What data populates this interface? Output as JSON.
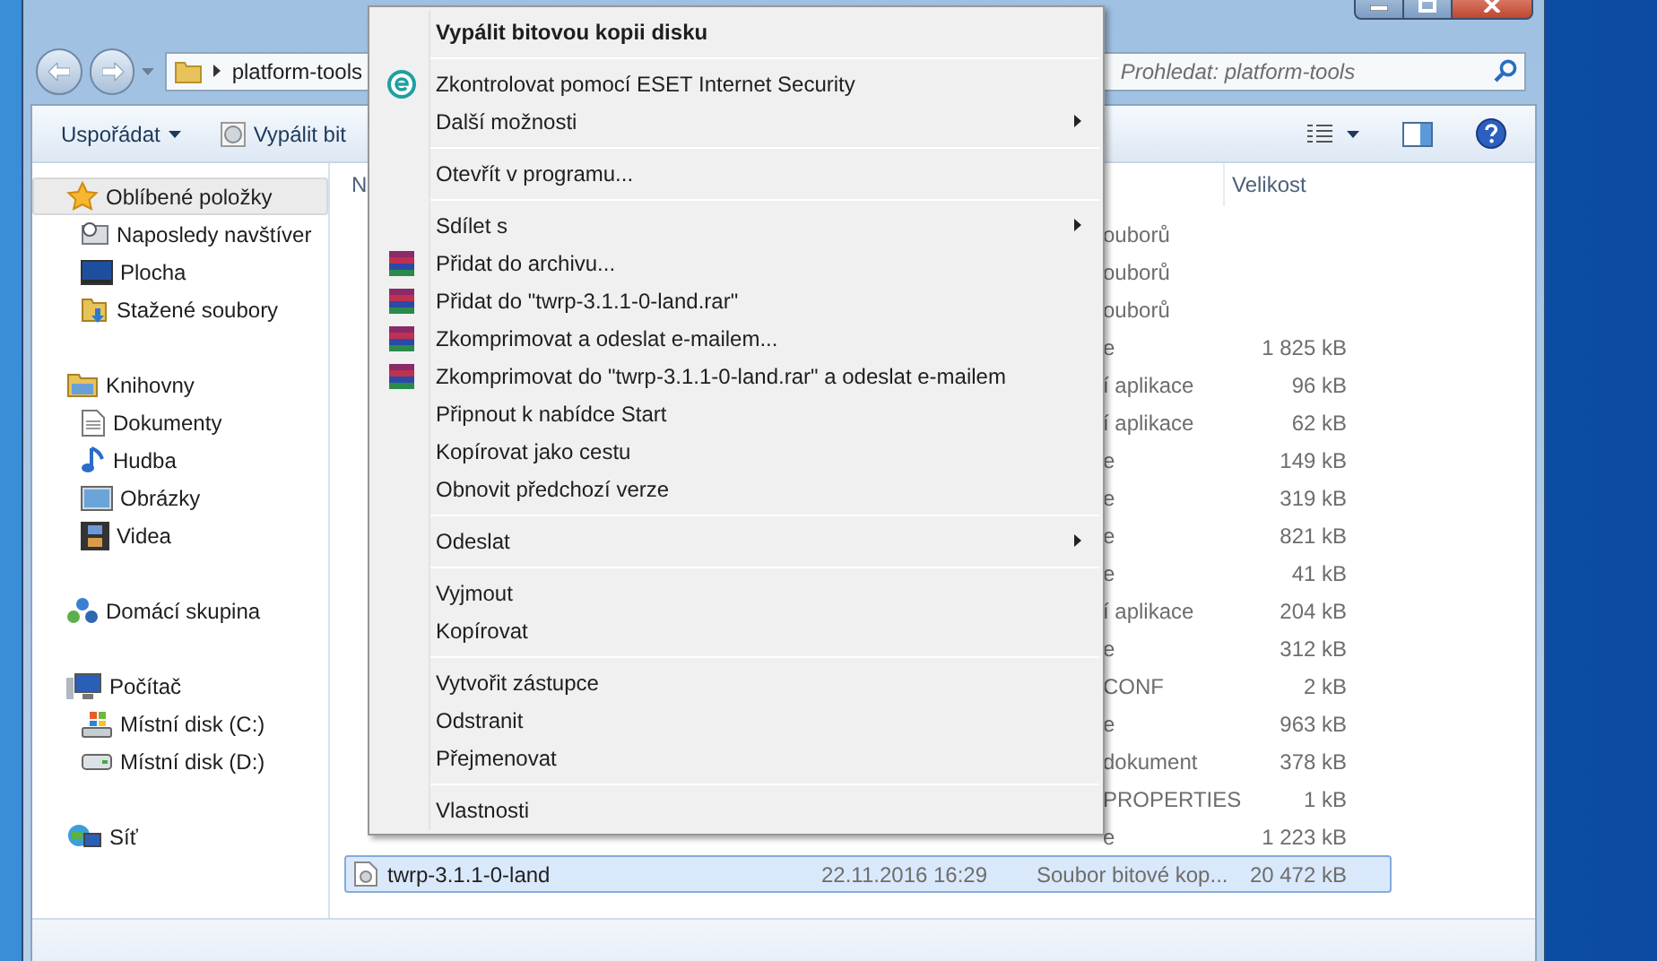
{
  "address_bar": {
    "path": "platform-tools"
  },
  "search": {
    "placeholder": "Prohledat: platform-tools"
  },
  "toolbar": {
    "buttons": [
      {
        "label": "Uspořádat",
        "kind": "dropdown"
      },
      {
        "label": "Vypálit bit",
        "kind": "burn"
      }
    ]
  },
  "sidebar": {
    "groups": [
      {
        "label": "Oblíbené položky",
        "selected": true,
        "children": [
          {
            "label": "Naposledy navštíver",
            "selected": false
          },
          {
            "label": "Plocha",
            "selected": false
          },
          {
            "label": "Stažené soubory",
            "selected": false
          }
        ]
      },
      {
        "label": "Knihovny",
        "selected": false,
        "children": [
          {
            "label": "Dokumenty",
            "selected": false
          },
          {
            "label": "Hudba",
            "selected": false
          },
          {
            "label": "Obrázky",
            "selected": false
          },
          {
            "label": "Videa",
            "selected": false
          }
        ]
      },
      {
        "label": "Domácí skupina",
        "selected": false
      },
      {
        "label": "Počítač",
        "selected": false,
        "children": [
          {
            "label": "Místní disk (C:)",
            "selected": false
          },
          {
            "label": "Místní disk (D:)",
            "selected": false
          }
        ]
      },
      {
        "label": "Síť",
        "selected": false
      }
    ]
  },
  "file_list": {
    "columns": [
      "N",
      "Velikost"
    ],
    "rows": [
      {
        "type": "ouborů",
        "selected": false
      },
      {
        "type": "ouborů",
        "selected": false
      },
      {
        "type": "ouborů",
        "selected": false
      },
      {
        "type": "e",
        "size": "1 825 kB",
        "selected": false
      },
      {
        "type": "í aplikace",
        "size": "96 kB",
        "selected": false
      },
      {
        "type": "í aplikace",
        "size": "62 kB",
        "selected": false
      },
      {
        "type": "e",
        "size": "149 kB",
        "selected": false
      },
      {
        "type": "e",
        "size": "319 kB",
        "selected": false
      },
      {
        "type": "e",
        "size": "821 kB",
        "selected": false
      },
      {
        "type": "e",
        "size": "41 kB",
        "selected": false
      },
      {
        "type": "í aplikace",
        "size": "204 kB",
        "selected": false
      },
      {
        "type": "e",
        "size": "312 kB",
        "selected": false
      },
      {
        "type": "CONF",
        "size": "2 kB",
        "selected": false
      },
      {
        "type": "e",
        "size": "963 kB",
        "selected": false
      },
      {
        "type": "dokument",
        "size": "378 kB",
        "selected": false
      },
      {
        "type": "PROPERTIES",
        "size": "1 kB",
        "selected": false
      },
      {
        "type": "e",
        "size": "1 223 kB",
        "selected": false
      },
      {
        "name": "twrp-3.1.1-0-land",
        "date": "22.11.2016 16:29",
        "type": "Soubor bitové kop...",
        "size": "20 472 kB",
        "selected": true
      }
    ]
  },
  "context_menu": {
    "items": [
      {
        "kind": "item",
        "label": "Vypálit bitovou kopii disku",
        "default": true,
        "submenu": false
      },
      {
        "kind": "separator"
      },
      {
        "kind": "antivirus",
        "label": "Zkontrolovat pomocí ESET Internet Security",
        "default": false,
        "submenu": false
      },
      {
        "kind": "item",
        "label": "Další možnosti",
        "default": false,
        "submenu": true
      },
      {
        "kind": "separator"
      },
      {
        "kind": "item",
        "label": "Otevřít v programu...",
        "default": false,
        "submenu": false
      },
      {
        "kind": "separator"
      },
      {
        "kind": "item",
        "label": "Sdílet s",
        "default": false,
        "submenu": true
      },
      {
        "kind": "archive",
        "label": "Přidat do archivu...",
        "default": false,
        "submenu": false
      },
      {
        "kind": "archive",
        "label": "Přidat do \"twrp-3.1.1-0-land.rar\"",
        "default": false,
        "submenu": false
      },
      {
        "kind": "archive",
        "label": "Zkomprimovat a odeslat e-mailem...",
        "default": false,
        "submenu": false
      },
      {
        "kind": "archive",
        "label": "Zkomprimovat do \"twrp-3.1.1-0-land.rar\" a odeslat e-mailem",
        "default": false,
        "submenu": false
      },
      {
        "kind": "item",
        "label": "Připnout k nabídce Start",
        "default": false,
        "submenu": false
      },
      {
        "kind": "item",
        "label": "Kopírovat jako cestu",
        "default": false,
        "submenu": false
      },
      {
        "kind": "item",
        "label": "Obnovit předchozí verze",
        "default": false,
        "submenu": false
      },
      {
        "kind": "separator"
      },
      {
        "kind": "item",
        "label": "Odeslat",
        "default": false,
        "submenu": true
      },
      {
        "kind": "separator"
      },
      {
        "kind": "item",
        "label": "Vyjmout",
        "default": false,
        "submenu": false
      },
      {
        "kind": "item",
        "label": "Kopírovat",
        "default": false,
        "submenu": false
      },
      {
        "kind": "separator"
      },
      {
        "kind": "item",
        "label": "Vytvořit zástupce",
        "default": false,
        "submenu": false
      },
      {
        "kind": "item",
        "label": "Odstranit",
        "default": false,
        "submenu": false
      },
      {
        "kind": "item",
        "label": "Přejmenovat",
        "default": false,
        "submenu": false
      },
      {
        "kind": "separator"
      },
      {
        "kind": "item",
        "label": "Vlastnosti",
        "default": false,
        "submenu": false
      }
    ]
  }
}
